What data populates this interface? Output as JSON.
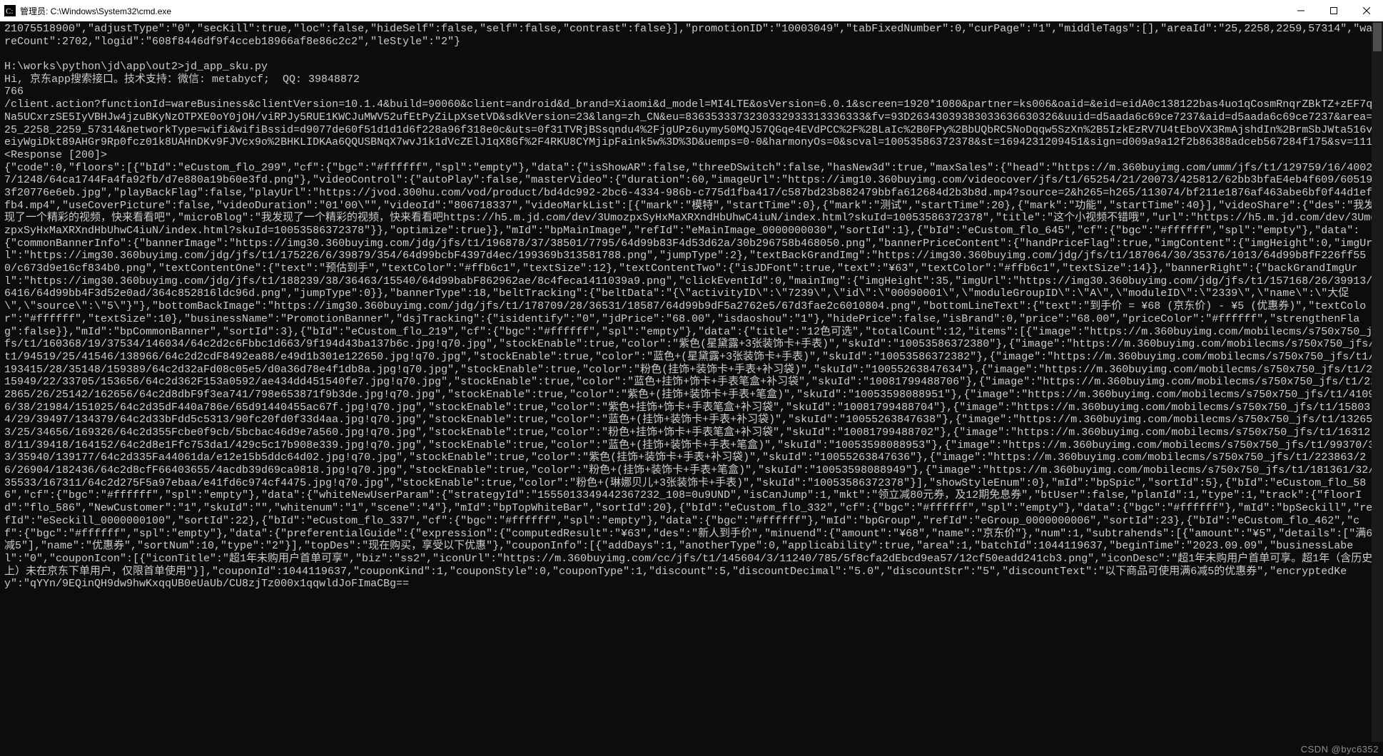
{
  "window": {
    "title": "管理员: C:\\Windows\\System32\\cmd.exe"
  },
  "watermark": "CSDN @byc6352",
  "terminal": {
    "top_fragment": "21075518900\",\"adjustType\":\"0\",\"secKill\":true,\"loc\":false,\"hideSelf\":false,\"self\":false,\"contrast\":false}],\"promotionID\":\"10003049\",\"tabFixedNumber\":0,\"curPage\":\"1\",\"middleTags\":[],\"areaId\":\"25,2258,2259,57314\",\"wareCount\":2702,\"logid\":\"608f8446df9f4cceb18966af8e86c2c2\",\"leStyle\":\"2\"}",
    "prompt": "H:\\works\\python\\jd\\app\\out2>jd_app_sku.py",
    "greeting": "Hi, 京东app搜索接口。技术支持：微信: metabycf;  QQ: 39848872",
    "number": "766",
    "request_url": "/client.action?functionId=wareBusiness&clientVersion=10.1.4&build=90060&client=android&d_brand=Xiaomi&d_model=MI4LTE&osVersion=6.0.1&screen=1920*1080&partner=ks006&oaid=&eid=eidA0c138122bas4uo1qCosmRnqrZBkTZ+zEF7qNa5UCxrzSE5IyVBHJw4jzuBKyNzOTPXE0oY0jOH/viRPJy5RUE1KWCJuMWV52ufEtPyZiLpXsetVD&sdkVersion=23&lang=zh_CN&eu=8363533373230332933313336333&fv=93D26343039383033636630326&uuid=d5aada6c69ce7237&aid=d5aada6c69ce7237&area=25_2258_2259_57314&networkType=wifi&wifiBssid=d9077de60f51d1d1d6f228a96f318e0c&uts=0f31TVRjBSsqndu4%2FjgUPz6uymy50MQJ57QGqe4EVdPCC%2F%2BLaIc%2B0FPy%2BbUQbRC5NoDqqw5SzXn%2B5IzkEzRV7U4tEboVX3RmAjshdIn%2BrmSbJWta516veiyWgiDkt89AHGr9Rp0fcz01k8UAHnDKv9FJVcx9o%2BHKLIDKAa6QQUSBNqX7wvJ1k1dVcZElJ1qX8Gf%2F4RKU8CYMjipFaink5w%3D%3D&uemps=0-0&harmonyOs=0&scval=10053586372378&st=1694231209451&sign=d009a9a12f2b86388adceb567284f175&sv=111",
    "response_status": "<Response [200]>",
    "response_body": "{\"code\":0,\"floors\":[{\"bId\":\"eCustom_flo_299\",\"cf\":{\"bgc\":\"#ffffff\",\"spl\":\"empty\"},\"data\":{\"isShowAR\":false,\"threeDSwitch\":false,\"hasNew3d\":true,\"maxSales\":{\"head\":\"https://m.360buyimg.com/umm/jfs/t1/129759/16/40027/1248/64ca1744Fa4fa92fb/d7e880a19b60e3fd.png\"},\"videoControl\":{\"autoPlay\":false,\"masterVideo\":{\"duration\":60,\"imageUrl\":\"https://img10.360buyimg.com/videocover/jfs/t1/65254/21/20073/425812/62bb3bfaE4eb4f609/605193f20776e6eb.jpg\",\"playBackFlag\":false,\"playUrl\":\"https://jvod.300hu.com/vod/product/bd4dc992-2bc6-4334-986b-c775d1fba417/c587bd23b882479bbfa612684d2b3b8d.mp4?source=2&h265=h265/113074/bf211e1876af463abe6bf0f44d1effb4.mp4\",\"useCoverPicture\":false,\"videoDuration\":\"01'00\\\"\",\"videoId\":\"806718337\",\"videoMarkList\":[{\"mark\":\"模特\",\"startTime\":0},{\"mark\":\"测试\",\"startTime\":20},{\"mark\":\"功能\",\"startTime\":40}],\"videoShare\":{\"des\":\"我发现了一个精彩的视频，快来看看吧\",\"microBlog\":\"我发现了一个精彩的视频，快来看看吧https://h5.m.jd.com/dev/3UmozpxSyHxMaXRXndHbUhwC4iuN/index.html?skuId=10053586372378\",\"title\":\"这个小视频不错哦\",\"url\":\"https://h5.m.jd.com/dev/3UmozpxSyHxMaXRXndHbUhwC4iuN/index.html?skuId=10053586372378\"}},\"optimize\":true}},\"mId\":\"bpMainImage\",\"refId\":\"eMainImage_0000000030\",\"sortId\":1},{\"bId\":\"eCustom_flo_645\",\"cf\":{\"bgc\":\"#ffffff\",\"spl\":\"empty\"},\"data\":{\"commonBannerInfo\":{\"bannerImage\":\"https://img30.360buyimg.com/jdg/jfs/t1/196878/37/38501/7795/64d99b83F4d53d62a/30b296758b468050.png\",\"bannerPriceContent\":{\"handPriceFlag\":true,\"imgContent\":{\"imgHeight\":0,\"imgUrl\":\"https://img30.360buyimg.com/jdg/jfs/t1/175226/6/39879/354/64d99bcbF4397d4ec/199369b313581788.png\",\"jumpType\":2},\"textBackGrandImg\":\"https://img30.360buyimg.com/jdg/jfs/t1/187064/30/35376/1013/64d99b8fF226ff550/c673d9e16cf834b0.png\",\"textContentOne\":{\"text\":\"预估到手\",\"textColor\":\"#ffb6c1\",\"textSize\":12},\"textContentTwo\":{\"isJDFont\":true,\"text\":\"¥63\",\"textColor\":\"#ffb6c1\",\"textSize\":14}},\"bannerRight\":{\"backGrandImgUrl\":\"https://img30.360buyimg.com/jdg/jfs/t1/188239/38/36463/15540/64d99babF862962ae/8c4feca1411039a9.png\",\"clickEventId\":0,\"mainImg\":{\"imgHeight\":35,\"imgUrl\":\"https://img30.360buyimg.com/jdg/jfs/t1/157168/26/39913/6416/64d99bb4F3d52e0ad/364c852816ldc96d.png\",\"jumpType\":0}},\"bannerType\":18,\"beltTracking\":{\"beltData\":\"{\\\"activityID\\\":\\\"7239\\\",\\\"id\\\":\\\"00090001\\\",\\\"moduleGroupID\\\":\\\"A\\\",\\\"moduleID\\\":\\\"2339\\\",\\\"name\\\":\\\"大促\\\",\\\"source\\\":\\\"5\\\"}\"},\"bottomBackImage\":\"https://img30.360buyimg.com/jdg/jfs/t1/178709/28/36531/18587/64d99b9dF5a2762e5/67d3fae2c6010804.png\",\"bottomLineText\":{\"text\":\"到手价 = ¥68 (京东价) - ¥5 (优惠券)\",\"textColor\":\"#ffffff\",\"textSize\":10},\"businessName\":\"PromotionBanner\",\"dsjTracking\":{\"isidentify\":\"0\",\"jdPrice\":\"68.00\",\"isdaoshou\":\"1\"},\"hidePrice\":false,\"isBrand\":0,\"price\":\"68.00\",\"priceColor\":\"#ffffff\",\"strengthenFlag\":false}},\"mId\":\"bpCommonBanner\",\"sortId\":3},{\"bId\":\"eCustom_flo_219\",\"cf\":{\"bgc\":\"#ffffff\",\"spl\":\"empty\"},\"data\":{\"title\":\"12色可选\",\"totalCount\":12,\"items\":[{\"image\":\"https://m.360buyimg.com/mobilecms/s750x750_jfs/t1/160368/19/37534/146034/64c2d2c6Fbbc1d663/9f194d43ba137b6c.jpg!q70.jpg\",\"stockEnable\":true,\"color\":\"紫色(星黛露+3张装饰卡+手表)\",\"skuId\":\"10053586372380\"},{\"image\":\"https://m.360buyimg.com/mobilecms/s750x750_jfs/t1/94519/25/41546/138966/64c2d2cdF8492ea88/e49d1b301e122650.jpg!q70.jpg\",\"stockEnable\":true,\"color\":\"蓝色+(星黛露+3张装饰卡+手表)\",\"skuId\":\"10053586372382\"},{\"image\":\"https://m.360buyimg.com/mobilecms/s750x750_jfs/t1/193415/28/35148/159389/64c2d32aFd08c05e5/d0a36d78e4f1db8a.jpg!q70.jpg\",\"stockEnable\":true,\"color\":\"粉色(挂饰+装饰卡+手表+补习袋)\",\"skuId\":\"10055263847634\"},{\"image\":\"https://m.360buyimg.com/mobilecms/s750x750_jfs/t1/215949/22/33705/153656/64c2d362F153a0592/ae434dd451540fe7.jpg!q70.jpg\",\"stockEnable\":true,\"color\":\"蓝色+挂饰+饰卡+手表笔盒+补习袋\",\"skuId\":\"10081799488706\"},{\"image\":\"https://m.360buyimg.com/mobilecms/s750x750_jfs/t1/222865/26/25142/162656/64c2d8dbF9f3ea741/798e653871f9b3de.jpg!q70.jpg\",\"stockEnable\":true,\"color\":\"紫色+(挂饰+装饰卡+手表+笔盒)\",\"skuId\":\"10053598088951\"},{\"image\":\"https://m.360buyimg.com/mobilecms/s750x750_jfs/t1/41096/38/21984/151025/64c2d35dF440a786e/65d91440455ac67f.jpg!q70.jpg\",\"stockEnable\":true,\"color\":\"紫色+挂饰+饰卡+手表笔盒+补习袋\",\"skuId\":\"10081799488704\"},{\"image\":\"https://m.360buyimg.com/mobilecms/s750x750_jfs/t1/158034/29/39497/134379/64c2d33bFdd5c5313/90fc20fd0f33d4aa.jpg!q70.jpg\",\"stockEnable\":true,\"color\":\"蓝色+(挂饰+装饰卡+手表+补习袋)\",\"skuId\":\"10055263847638\"},{\"image\":\"https://m.360buyimg.com/mobilecms/s750x750_jfs/t1/132653/25/34656/169326/64c2d355Fcbe0f9cb/5bcbac46d9e7a560.jpg!q70.jpg\",\"stockEnable\":true,\"color\":\"粉色+挂饰+饰卡+手表笔盒+补习袋\",\"skuId\":\"10081799488702\"},{\"image\":\"https://m.360buyimg.com/mobilecms/s750x750_jfs/t1/163128/11/39418/164152/64c2d8e1Ffc753da1/429c5c17b908e339.jpg!q70.jpg\",\"stockEnable\":true,\"color\":\"蓝色+(挂饰+装饰卡+手表+笔盒)\",\"skuId\":\"10053598088953\"},{\"image\":\"https://m.360buyimg.com/mobilecms/s750x750_jfs/t1/99370/33/35940/139177/64c2d335Fa44061da/e12e15b5ddc64d02.jpg!q70.jpg\",\"stockEnable\":true,\"color\":\"紫色(挂饰+装饰卡+手表+补习袋)\",\"skuId\":\"10055263847636\"},{\"image\":\"https://m.360buyimg.com/mobilecms/s750x750_jfs/t1/223863/26/26904/182436/64c2d8cfF66403655/4acdb39d69ca9818.jpg!q70.jpg\",\"stockEnable\":true,\"color\":\"粉色+(挂饰+装饰卡+手表+笔盒)\",\"skuId\":\"10053598088949\"},{\"image\":\"https://m.360buyimg.com/mobilecms/s750x750_jfs/t1/181361/32/35533/167311/64c2d275F5a97ebaa/e41fd6c974cf4475.jpg!q70.jpg\",\"stockEnable\":true,\"color\":\"粉色+(琳娜贝儿+3张装饰卡+手表)\",\"skuId\":\"10053586372378\"}],\"showStyleEnum\":0},\"mId\":\"bpSpic\",\"sortId\":5},{\"bId\":\"eCustom_flo_586\",\"cf\":{\"bgc\":\"#ffffff\",\"spl\":\"empty\"},\"data\":{\"whiteNewUserParam\":{\"strategyId\":\"1555013349442367232_108=0u9UND\",\"isCanJump\":1,\"mkt\":\"领立减80元券，及12期免息券\",\"btUser\":false,\"planId\":1,\"type\":1,\"track\":{\"floorId\":\"flo_586\",\"NewCustomer\":\"1\",\"skuId\":\"\",\"whitenum\":\"1\",\"scene\":\"4\"},\"mId\":\"bpTopWhiteBar\",\"sortId\":20},{\"bId\":\"eCustom_flo_332\",\"cf\":{\"bgc\":\"#ffffff\",\"spl\":\"empty\"},\"data\":{\"bgc\":\"#ffffff\"},\"mId\":\"bpSeckill\",\"refId\":\"eSeckill_0000000100\",\"sortId\":22},{\"bId\":\"eCustom_flo_337\",\"cf\":{\"bgc\":\"#ffffff\",\"spl\":\"empty\"},\"data\":{\"bgc\":\"#ffffff\"},\"mId\":\"bpGroup\",\"refId\":\"eGroup_0000000006\",\"sortId\":23},{\"bId\":\"eCustom_flo_462\",\"cf\":{\"bgc\":\"#ffffff\",\"spl\":\"empty\"},\"data\":{\"preferentialGuide\":{\"expression\":{\"computedResult\":\"¥63\",\"des\":\"新人到手价\",\"minuend\":{\"amount\":\"¥68\",\"name\":\"京东价\"},\"num\":1,\"subtrahends\":[{\"amount\":\"¥5\",\"details\":[\"满6减5\"],\"name\":\"优惠券\",\"sortNum\":10,\"type\":\"2\"}],\"topDes\":\"现在购买，享受以下优惠\"},\"couponInfo\":[{\"addDays\":1,\"anotherType\":0,\"applicability\":true,\"area\":1,\"batchId\":1044119637,\"beginTime\":\"2023.09.09\",\"businessLabel\":\"0\",\"couponIcon\":[{\"iconTitle\":\"超1年未购用户首单可享\",\"biz\":\"ss2\",\"iconUrl\":\"https://m.360buyimg.com/cc/jfs/t1/145604/3/11240/785/5f8cfa2dEbcd9ea57/12cf50eadd241cb3.png\",\"iconDesc\":\"超1年未购用户首单可享。超1年（含历史上）未在京东下单用户，仅限首单使用\"}],\"couponId\":1044119637,\"couponKind\":1,\"couponStyle\":0,\"couponType\":1,\"discount\":5,\"discountDecimal\":\"5.0\",\"discountStr\":\"5\",\"discountText\":\"以下商品可使用满6减5的优惠券\",\"encryptedKey\":\"qYYn/9EQinQH9dw9hwKxqqUB0eUaUb/CU8zjTz000x1qqwldJoFImaCBg==",
    "chart_data": {
      "type": "table",
      "title": "JD App SKU items (12色可选)",
      "columns": [
        "skuId",
        "color",
        "stockEnable"
      ],
      "rows": [
        [
          "10053586372380",
          "紫色(星黛露+3张装饰卡+手表)",
          true
        ],
        [
          "10053586372382",
          "蓝色+(星黛露+3张装饰卡+手表)",
          true
        ],
        [
          "10055263847634",
          "粉色(挂饰+装饰卡+手表+补习袋)",
          true
        ],
        [
          "10081799488706",
          "蓝色+挂饰+饰卡+手表笔盒+补习袋",
          true
        ],
        [
          "10053598088951",
          "紫色+(挂饰+装饰卡+手表+笔盒)",
          true
        ],
        [
          "10081799488704",
          "紫色+挂饰+饰卡+手表笔盒+补习袋",
          true
        ],
        [
          "10055263847638",
          "蓝色+(挂饰+装饰卡+手表+补习袋)",
          true
        ],
        [
          "10081799488702",
          "粉色+挂饰+饰卡+手表笔盒+补习袋",
          true
        ],
        [
          "10053598088953",
          "蓝色+(挂饰+装饰卡+手表+笔盒)",
          true
        ],
        [
          "10055263847636",
          "紫色(挂饰+装饰卡+手表+补习袋)",
          true
        ],
        [
          "10053598088949",
          "粉色+(挂饰+装饰卡+手表+笔盒)",
          true
        ],
        [
          "10053586372378",
          "粉色+(琳娜贝儿+3张装饰卡+手表)",
          true
        ]
      ]
    }
  }
}
